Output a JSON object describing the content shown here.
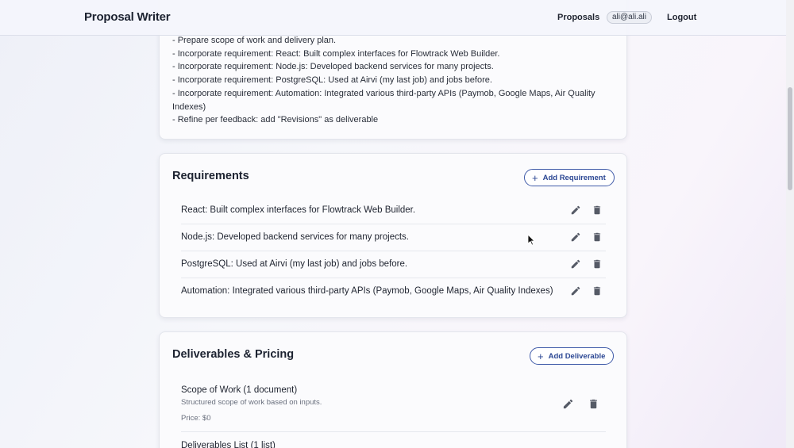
{
  "topbar": {
    "brand": "Proposal Writer",
    "nav_proposals": "Proposals",
    "user_email": "ali@ali.ali",
    "logout": "Logout"
  },
  "plan": {
    "lines": [
      "- Prepare scope of work and delivery plan.",
      "- Incorporate requirement: React: Built complex interfaces for Flowtrack Web Builder.",
      "- Incorporate requirement: Node.js: Developed backend services for many projects.",
      "- Incorporate requirement: PostgreSQL: Used at Airvi (my last job) and jobs before.",
      "- Incorporate requirement: Automation: Integrated various third-party APIs (Paymob, Google Maps, Air Quality Indexes)",
      "- Refine per feedback: add \"Revisions\" as deliverable"
    ]
  },
  "requirements": {
    "title": "Requirements",
    "add_label": "Add Requirement",
    "items": [
      "React: Built complex interfaces for Flowtrack Web Builder.",
      "Node.js: Developed backend services for many projects.",
      "PostgreSQL: Used at Airvi (my last job) and jobs before.",
      "Automation: Integrated various third-party APIs (Paymob, Google Maps, Air Quality Indexes)"
    ]
  },
  "deliverables": {
    "title": "Deliverables & Pricing",
    "add_label": "Add Deliverable",
    "items": [
      {
        "title": "Scope of Work (1 document)",
        "description": "Structured scope of work based on inputs.",
        "price": "Price: $0"
      }
    ],
    "next_title": "Deliverables List (1 list)"
  },
  "colors": {
    "accent": "#2c4894",
    "text": "#1f2430",
    "muted": "#6a707e"
  },
  "icons": {
    "edit": "pencil-icon",
    "delete": "trash-icon",
    "add": "plus-icon"
  }
}
